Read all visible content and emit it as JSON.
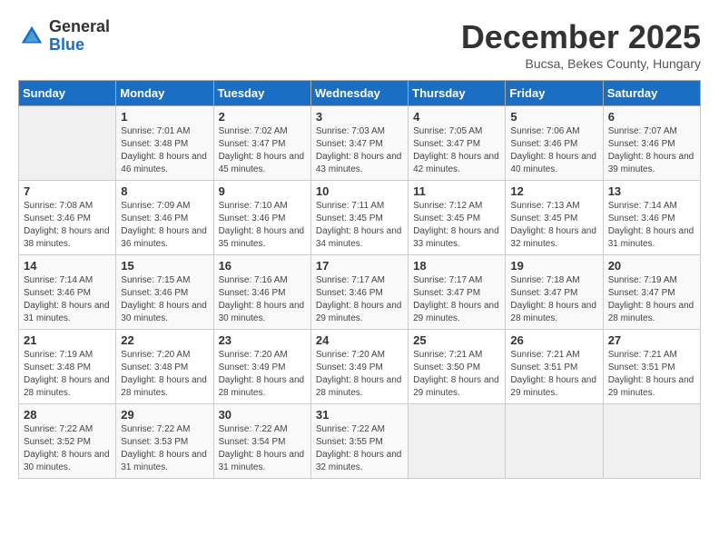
{
  "header": {
    "logo_line1": "General",
    "logo_line2": "Blue",
    "month_title": "December 2025",
    "location": "Bucsa, Bekes County, Hungary"
  },
  "days_of_week": [
    "Sunday",
    "Monday",
    "Tuesday",
    "Wednesday",
    "Thursday",
    "Friday",
    "Saturday"
  ],
  "weeks": [
    [
      {
        "day": "",
        "sunrise": "",
        "sunset": "",
        "daylight": "",
        "empty": true
      },
      {
        "day": "1",
        "sunrise": "Sunrise: 7:01 AM",
        "sunset": "Sunset: 3:48 PM",
        "daylight": "Daylight: 8 hours and 46 minutes."
      },
      {
        "day": "2",
        "sunrise": "Sunrise: 7:02 AM",
        "sunset": "Sunset: 3:47 PM",
        "daylight": "Daylight: 8 hours and 45 minutes."
      },
      {
        "day": "3",
        "sunrise": "Sunrise: 7:03 AM",
        "sunset": "Sunset: 3:47 PM",
        "daylight": "Daylight: 8 hours and 43 minutes."
      },
      {
        "day": "4",
        "sunrise": "Sunrise: 7:05 AM",
        "sunset": "Sunset: 3:47 PM",
        "daylight": "Daylight: 8 hours and 42 minutes."
      },
      {
        "day": "5",
        "sunrise": "Sunrise: 7:06 AM",
        "sunset": "Sunset: 3:46 PM",
        "daylight": "Daylight: 8 hours and 40 minutes."
      },
      {
        "day": "6",
        "sunrise": "Sunrise: 7:07 AM",
        "sunset": "Sunset: 3:46 PM",
        "daylight": "Daylight: 8 hours and 39 minutes."
      }
    ],
    [
      {
        "day": "7",
        "sunrise": "Sunrise: 7:08 AM",
        "sunset": "Sunset: 3:46 PM",
        "daylight": "Daylight: 8 hours and 38 minutes."
      },
      {
        "day": "8",
        "sunrise": "Sunrise: 7:09 AM",
        "sunset": "Sunset: 3:46 PM",
        "daylight": "Daylight: 8 hours and 36 minutes."
      },
      {
        "day": "9",
        "sunrise": "Sunrise: 7:10 AM",
        "sunset": "Sunset: 3:46 PM",
        "daylight": "Daylight: 8 hours and 35 minutes."
      },
      {
        "day": "10",
        "sunrise": "Sunrise: 7:11 AM",
        "sunset": "Sunset: 3:45 PM",
        "daylight": "Daylight: 8 hours and 34 minutes."
      },
      {
        "day": "11",
        "sunrise": "Sunrise: 7:12 AM",
        "sunset": "Sunset: 3:45 PM",
        "daylight": "Daylight: 8 hours and 33 minutes."
      },
      {
        "day": "12",
        "sunrise": "Sunrise: 7:13 AM",
        "sunset": "Sunset: 3:45 PM",
        "daylight": "Daylight: 8 hours and 32 minutes."
      },
      {
        "day": "13",
        "sunrise": "Sunrise: 7:14 AM",
        "sunset": "Sunset: 3:46 PM",
        "daylight": "Daylight: 8 hours and 31 minutes."
      }
    ],
    [
      {
        "day": "14",
        "sunrise": "Sunrise: 7:14 AM",
        "sunset": "Sunset: 3:46 PM",
        "daylight": "Daylight: 8 hours and 31 minutes."
      },
      {
        "day": "15",
        "sunrise": "Sunrise: 7:15 AM",
        "sunset": "Sunset: 3:46 PM",
        "daylight": "Daylight: 8 hours and 30 minutes."
      },
      {
        "day": "16",
        "sunrise": "Sunrise: 7:16 AM",
        "sunset": "Sunset: 3:46 PM",
        "daylight": "Daylight: 8 hours and 30 minutes."
      },
      {
        "day": "17",
        "sunrise": "Sunrise: 7:17 AM",
        "sunset": "Sunset: 3:46 PM",
        "daylight": "Daylight: 8 hours and 29 minutes."
      },
      {
        "day": "18",
        "sunrise": "Sunrise: 7:17 AM",
        "sunset": "Sunset: 3:47 PM",
        "daylight": "Daylight: 8 hours and 29 minutes."
      },
      {
        "day": "19",
        "sunrise": "Sunrise: 7:18 AM",
        "sunset": "Sunset: 3:47 PM",
        "daylight": "Daylight: 8 hours and 28 minutes."
      },
      {
        "day": "20",
        "sunrise": "Sunrise: 7:19 AM",
        "sunset": "Sunset: 3:47 PM",
        "daylight": "Daylight: 8 hours and 28 minutes."
      }
    ],
    [
      {
        "day": "21",
        "sunrise": "Sunrise: 7:19 AM",
        "sunset": "Sunset: 3:48 PM",
        "daylight": "Daylight: 8 hours and 28 minutes."
      },
      {
        "day": "22",
        "sunrise": "Sunrise: 7:20 AM",
        "sunset": "Sunset: 3:48 PM",
        "daylight": "Daylight: 8 hours and 28 minutes."
      },
      {
        "day": "23",
        "sunrise": "Sunrise: 7:20 AM",
        "sunset": "Sunset: 3:49 PM",
        "daylight": "Daylight: 8 hours and 28 minutes."
      },
      {
        "day": "24",
        "sunrise": "Sunrise: 7:20 AM",
        "sunset": "Sunset: 3:49 PM",
        "daylight": "Daylight: 8 hours and 28 minutes."
      },
      {
        "day": "25",
        "sunrise": "Sunrise: 7:21 AM",
        "sunset": "Sunset: 3:50 PM",
        "daylight": "Daylight: 8 hours and 29 minutes."
      },
      {
        "day": "26",
        "sunrise": "Sunrise: 7:21 AM",
        "sunset": "Sunset: 3:51 PM",
        "daylight": "Daylight: 8 hours and 29 minutes."
      },
      {
        "day": "27",
        "sunrise": "Sunrise: 7:21 AM",
        "sunset": "Sunset: 3:51 PM",
        "daylight": "Daylight: 8 hours and 29 minutes."
      }
    ],
    [
      {
        "day": "28",
        "sunrise": "Sunrise: 7:22 AM",
        "sunset": "Sunset: 3:52 PM",
        "daylight": "Daylight: 8 hours and 30 minutes."
      },
      {
        "day": "29",
        "sunrise": "Sunrise: 7:22 AM",
        "sunset": "Sunset: 3:53 PM",
        "daylight": "Daylight: 8 hours and 31 minutes."
      },
      {
        "day": "30",
        "sunrise": "Sunrise: 7:22 AM",
        "sunset": "Sunset: 3:54 PM",
        "daylight": "Daylight: 8 hours and 31 minutes."
      },
      {
        "day": "31",
        "sunrise": "Sunrise: 7:22 AM",
        "sunset": "Sunset: 3:55 PM",
        "daylight": "Daylight: 8 hours and 32 minutes."
      },
      {
        "day": "",
        "sunrise": "",
        "sunset": "",
        "daylight": "",
        "empty": true
      },
      {
        "day": "",
        "sunrise": "",
        "sunset": "",
        "daylight": "",
        "empty": true
      },
      {
        "day": "",
        "sunrise": "",
        "sunset": "",
        "daylight": "",
        "empty": true
      }
    ]
  ]
}
